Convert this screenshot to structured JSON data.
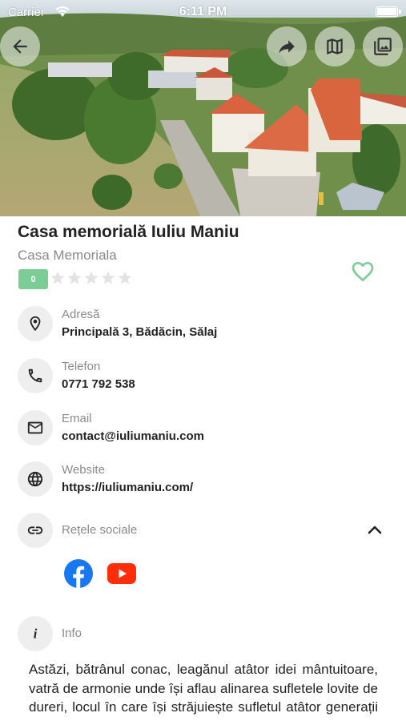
{
  "status_bar": {
    "carrier": "Carrier",
    "time": "6:11 PM"
  },
  "header": {
    "photo_alt": "aerial photo of memorial house",
    "buttons": [
      "arrow-left-icon",
      "share-icon",
      "map-icon",
      "gallery-icon"
    ]
  },
  "place": {
    "title": "Casa memorială Iuliu Maniu",
    "category": "Casa Memoriala",
    "rating_count": "0",
    "stars": 0,
    "max_stars": 5
  },
  "details": {
    "address_label": "Adresă",
    "address_value": "Principală 3, Bădăcin, Sălaj",
    "phone_label": "Telefon",
    "phone_value": "0771 792 538",
    "email_label": "Email",
    "email_value": "contact@iuliumaniu.com",
    "website_label": "Website",
    "website_value": "https://iuliumaniu.com/",
    "social_label": "Rețele sociale",
    "info_label": "Info",
    "info_text": "Astăzi, bătrânul conac, leagănul atâtor idei mântuitoare, vatră de armonie unde își aflau alinarea sufletele lovite de dureri, locul în care își străjuiește sufletul atâtor generații de români"
  },
  "colors": {
    "accent_green": "#7ccc96",
    "facebook": "#1877f2",
    "youtube": "#ff2d0a"
  }
}
